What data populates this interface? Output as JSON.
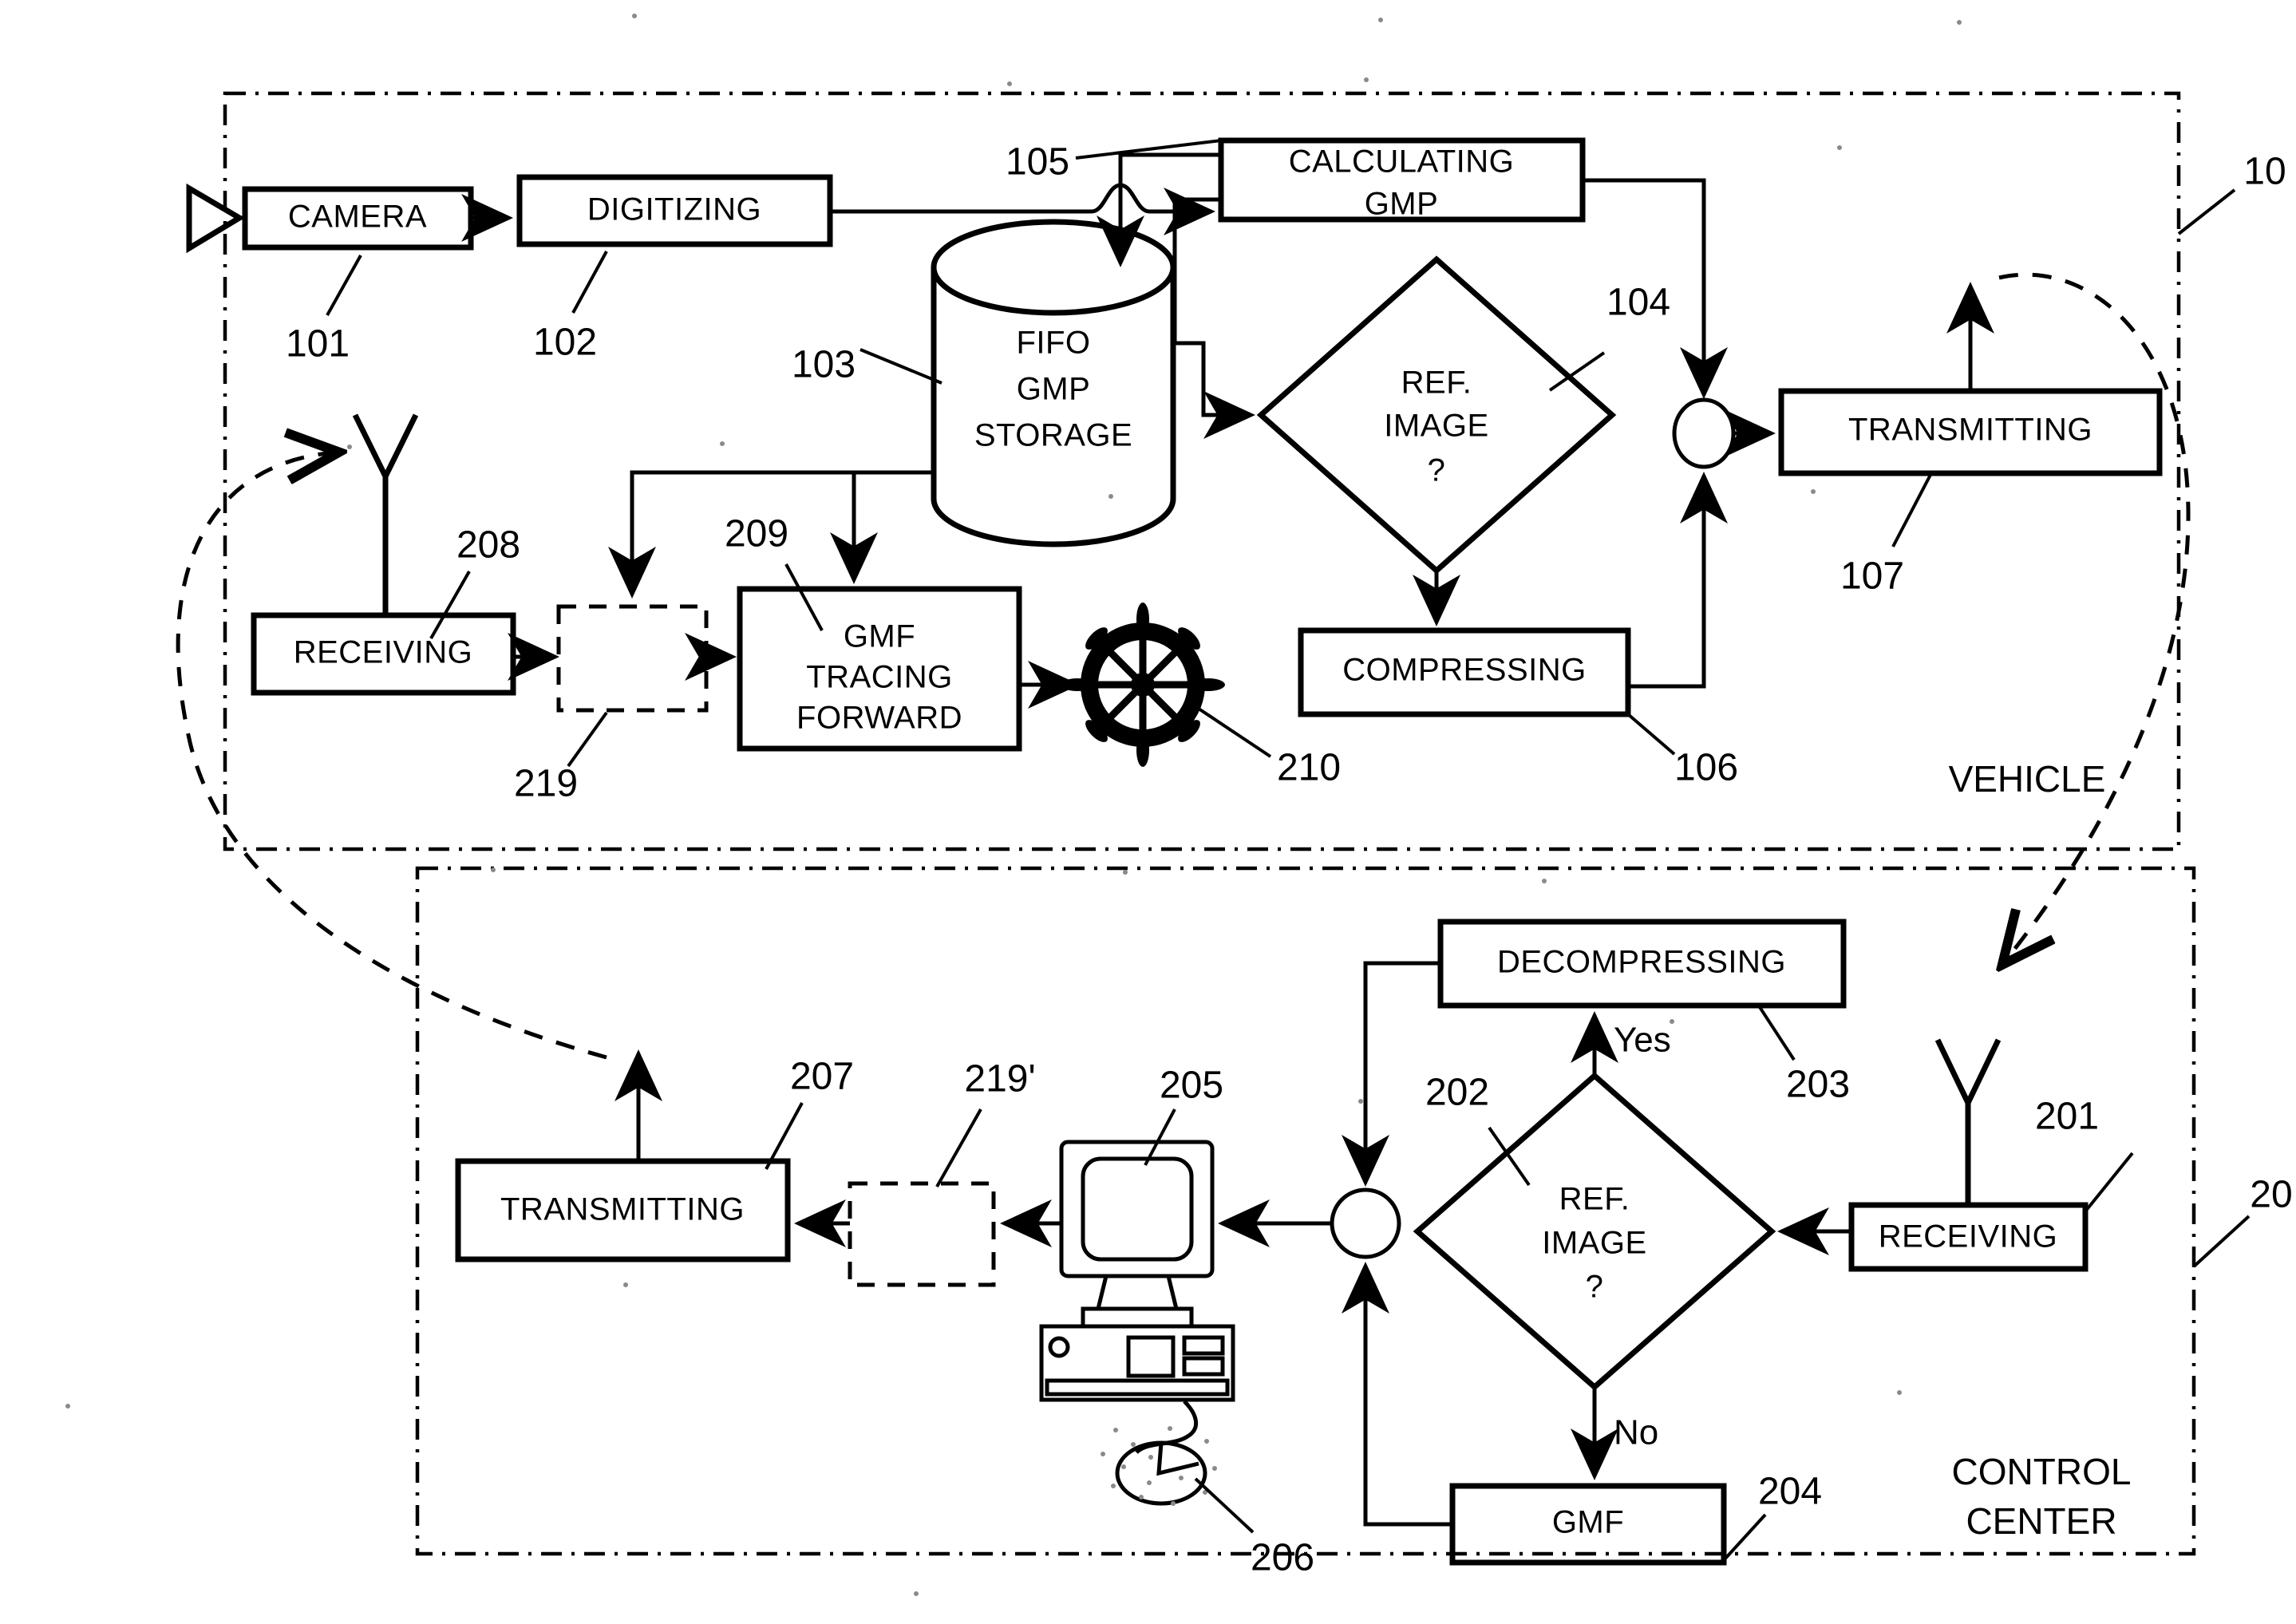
{
  "figure": {
    "type": "patent-block-diagram",
    "zones": [
      {
        "id": "vehicle",
        "label": "VEHICLE",
        "ref": "10"
      },
      {
        "id": "control_center",
        "label": "CONTROL\nCENTER",
        "ref": "20",
        "label_line1": "CONTROL",
        "label_line2": "CENTER"
      }
    ]
  },
  "vehicle": {
    "zone_label": "VEHICLE",
    "zone_ref": "10",
    "blocks": [
      {
        "id": "camera",
        "label": "CAMERA",
        "ref": "101"
      },
      {
        "id": "digitizing",
        "label": "DIGITIZING",
        "ref": "102"
      },
      {
        "id": "fifo",
        "label_line1": "FIFO",
        "label_line2": "GMP",
        "label_line3": "STORAGE",
        "ref": "103"
      },
      {
        "id": "refimage",
        "label_line1": "REF.",
        "label_line2": "IMAGE",
        "label_line3": "?",
        "ref": "104"
      },
      {
        "id": "calcgmp",
        "label_line1": "CALCULATING",
        "label_line2": "GMP",
        "ref": "105"
      },
      {
        "id": "compressing",
        "label": "COMPRESSING",
        "ref": "106"
      },
      {
        "id": "transmitting",
        "label": "TRANSMITTING",
        "ref": "107"
      },
      {
        "id": "receiving",
        "label": "RECEIVING",
        "ref": "208"
      },
      {
        "id": "optional",
        "label": "",
        "ref": "219"
      },
      {
        "id": "gmftrace",
        "label_line1": "GMF",
        "label_line2": "TRACING",
        "label_line3": "FORWARD",
        "ref": "209"
      },
      {
        "id": "helm",
        "label": "",
        "ref": "210"
      }
    ]
  },
  "control_center": {
    "zone_label_line1": "CONTROL",
    "zone_label_line2": "CENTER",
    "zone_ref": "20",
    "blocks": [
      {
        "id": "cc_receiving",
        "label": "RECEIVING",
        "ref": "201"
      },
      {
        "id": "cc_refimage",
        "label_line1": "REF.",
        "label_line2": "IMAGE",
        "label_line3": "?",
        "ref": "202"
      },
      {
        "id": "cc_decompressing",
        "label": "DECOMPRESSING",
        "ref": "203"
      },
      {
        "id": "cc_gmf",
        "label": "GMF",
        "ref": "204"
      },
      {
        "id": "cc_computer",
        "label": "",
        "ref": "205"
      },
      {
        "id": "cc_mouse",
        "label": "",
        "ref": "206"
      },
      {
        "id": "cc_transmitting",
        "label": "TRANSMITTING",
        "ref": "207"
      },
      {
        "id": "cc_optional",
        "label": "",
        "ref": "219'"
      }
    ],
    "edge_labels": {
      "yes": "Yes",
      "no": "No"
    }
  },
  "colors": {
    "ink": "#000000",
    "paper": "#ffffff"
  }
}
